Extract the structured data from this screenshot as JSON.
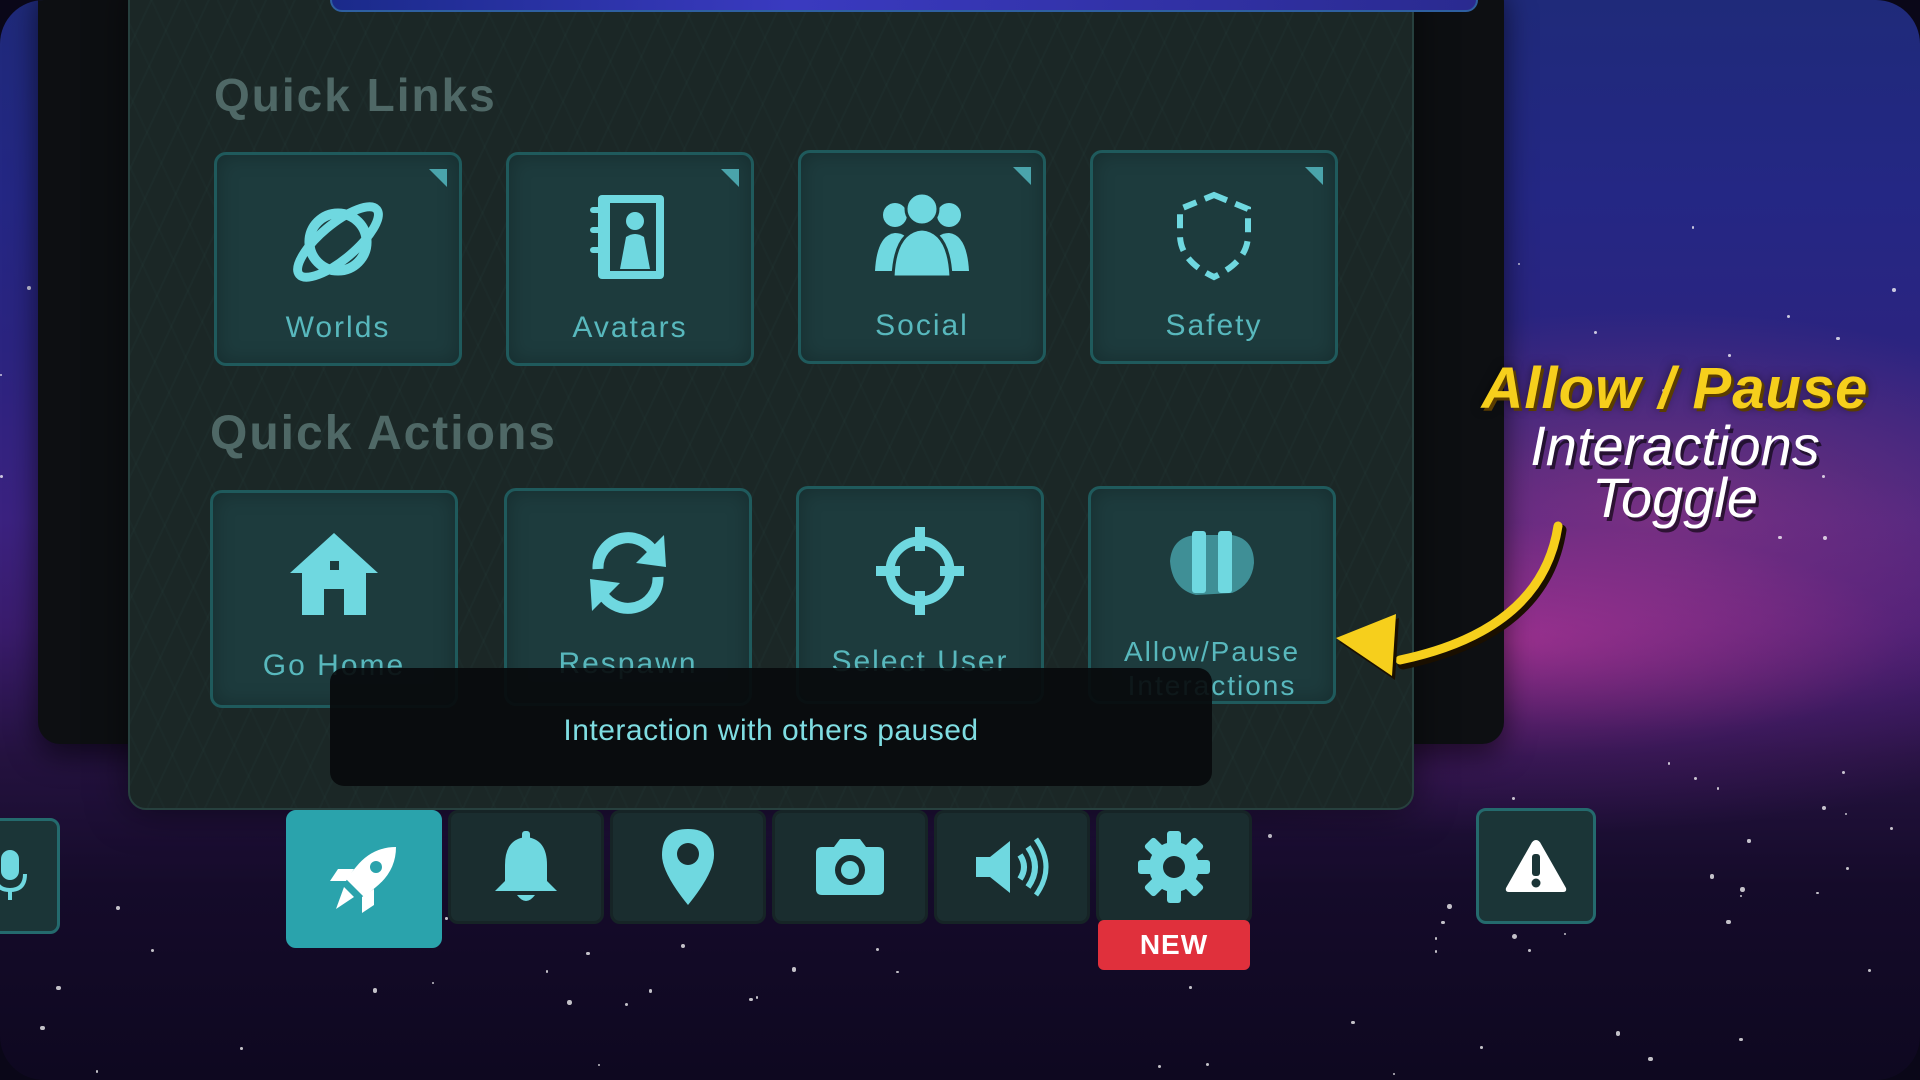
{
  "quick_links": {
    "title": "Quick Links",
    "tiles": [
      {
        "label": "Worlds",
        "icon": "planet-icon"
      },
      {
        "label": "Avatars",
        "icon": "avatar-book-icon"
      },
      {
        "label": "Social",
        "icon": "people-icon"
      },
      {
        "label": "Safety",
        "icon": "shield-icon"
      }
    ]
  },
  "quick_actions": {
    "title": "Quick Actions",
    "tiles": [
      {
        "label": "Go Home",
        "icon": "home-icon"
      },
      {
        "label": "Respawn",
        "icon": "respawn-icon"
      },
      {
        "label": "Select User",
        "icon": "crosshair-icon"
      },
      {
        "label_line1": "Allow/Pause",
        "label_line2": "Interactions",
        "icon": "pause-hand-icon"
      }
    ]
  },
  "toast": {
    "text": "Interaction with others paused"
  },
  "dock": {
    "items": [
      {
        "name": "launch-pad",
        "icon": "rocket-icon",
        "active": true
      },
      {
        "name": "notifications",
        "icon": "bell-icon"
      },
      {
        "name": "location",
        "icon": "map-pin-icon"
      },
      {
        "name": "camera",
        "icon": "camera-icon"
      },
      {
        "name": "audio",
        "icon": "speaker-icon"
      },
      {
        "name": "settings",
        "icon": "gear-icon"
      }
    ],
    "new_badge": "NEW"
  },
  "callout": {
    "line1": "Allow / Pause",
    "line2": "Interactions",
    "line3": "Toggle"
  },
  "colors": {
    "accent": "#2aa3ac",
    "tile_bg": "#1d3b3d",
    "icon": "#6fd8e0",
    "callout_yellow": "#f6cf1c",
    "badge_red": "#e0303c"
  }
}
